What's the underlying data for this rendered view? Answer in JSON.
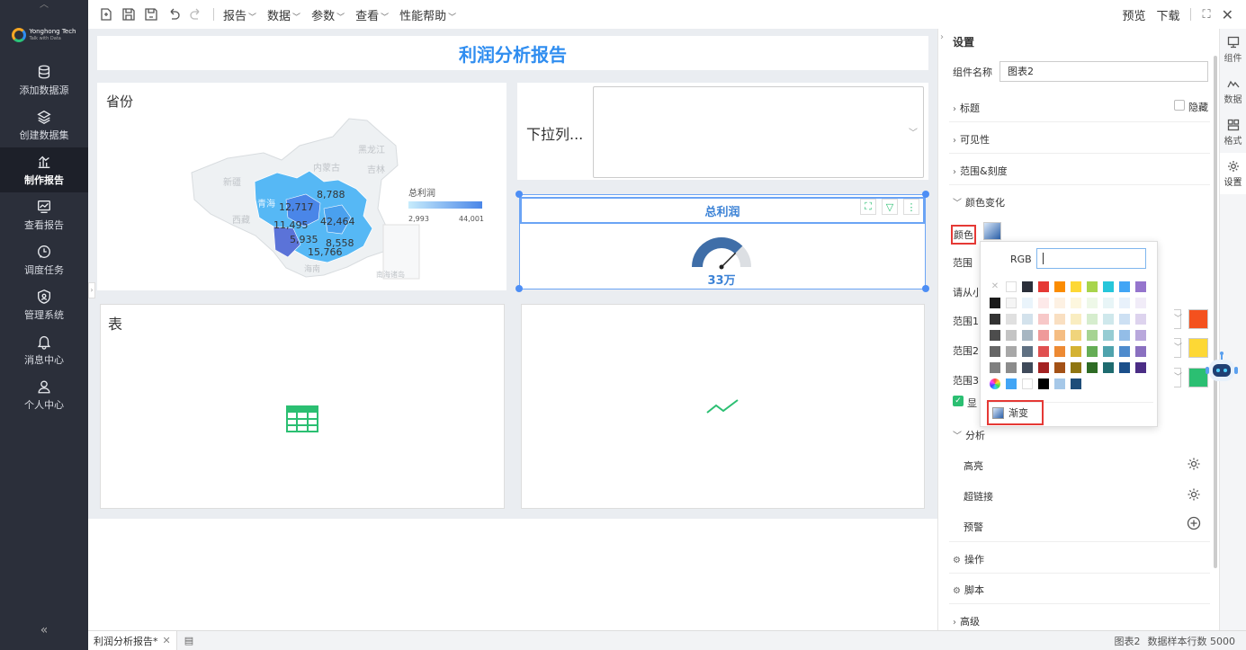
{
  "sidebar": {
    "brand": "Yonghong Tech",
    "brand_sub": "Talk with Data",
    "items": [
      {
        "label": "添加数据源",
        "icon": "database-icon"
      },
      {
        "label": "创建数据集",
        "icon": "layers-icon"
      },
      {
        "label": "制作报告",
        "icon": "chart-report-icon",
        "active": true
      },
      {
        "label": "查看报告",
        "icon": "view-report-icon"
      },
      {
        "label": "调度任务",
        "icon": "clock-icon"
      },
      {
        "label": "管理系统",
        "icon": "shield-icon"
      },
      {
        "label": "消息中心",
        "icon": "bell-icon"
      },
      {
        "label": "个人中心",
        "icon": "user-icon"
      }
    ],
    "collapse": "«"
  },
  "toolbar": {
    "menus": [
      "报告",
      "数据",
      "参数",
      "查看",
      "性能帮助"
    ],
    "preview": "预览",
    "download": "下载"
  },
  "report": {
    "title": "利润分析报告",
    "map": {
      "title": "省份",
      "legend_title": "总利润",
      "legend_min": "2,993",
      "legend_max": "44,001",
      "regions": [
        "黑龙江",
        "吉林",
        "内蒙古",
        "新疆",
        "西藏",
        "青海",
        "海南",
        "南海诸岛"
      ],
      "values": [
        "8,788",
        "12,717",
        "42,464",
        "11,495",
        "5,935",
        "8,558",
        "15,766"
      ]
    },
    "dropdown": {
      "label": "下拉列..."
    },
    "gauge": {
      "title": "总利润",
      "value": "33万",
      "fraction": 0.75
    },
    "table": {
      "title": "表"
    }
  },
  "panel": {
    "title": "设置",
    "name_label": "组件名称",
    "name_value": "图表2",
    "sections": {
      "title": "标题",
      "hide": "隐藏",
      "visibility": "可见性",
      "range_scale": "范围&刻度",
      "color_change": "颜色变化",
      "color": "颜色",
      "range": "范围",
      "hint": "请从小",
      "range1": "范围1",
      "range2": "范围2",
      "range3": "范围3",
      "show": "显",
      "analysis": "分析",
      "highlight": "高亮",
      "hyperlink": "超链接",
      "alert": "预警",
      "operation": "操作",
      "script": "脚本",
      "advanced": "高级"
    },
    "range_colors": [
      "#f4511e",
      "#fdd835",
      "#2bbf72"
    ]
  },
  "tabs": [
    "组件",
    "数据",
    "格式",
    "设置"
  ],
  "popover": {
    "rgb_label": "RGB",
    "gradient_label": "渐变",
    "row0": [
      "none",
      "#ffffff",
      "#2b2f3a",
      "#e53935",
      "#fb8c00",
      "#fdd835",
      "#a8d44b",
      "#26c6da",
      "#42a5f5",
      "#9575cd"
    ],
    "grid_rows": [
      [
        "#1b1b1b",
        "#f5f5f5",
        "#eaf4fb",
        "#fde9e9",
        "#fdf1e3",
        "#fdf7de",
        "#eef8e8",
        "#e8f5f7",
        "#e8f1fb",
        "#f1ecf8"
      ],
      [
        "#333333",
        "#e0e0e0",
        "#d3e2ec",
        "#f7c8c8",
        "#f9dfc1",
        "#f9edc1",
        "#d6edce",
        "#cfe8ec",
        "#cde0f3",
        "#ddd3ee"
      ],
      [
        "#4d4d4d",
        "#c4c4c4",
        "#a7b6c2",
        "#ef9a9a",
        "#f5bd82",
        "#f0d47c",
        "#a6d392",
        "#96ccd3",
        "#93bde7",
        "#b9a8dc"
      ],
      [
        "#666666",
        "#a8a8a8",
        "#5f7082",
        "#e05050",
        "#ed8a33",
        "#d4b232",
        "#65ad55",
        "#4fa3ad",
        "#4e8bcd",
        "#8a70c0"
      ],
      [
        "#808080",
        "#8c8c8c",
        "#3f4a5a",
        "#a32222",
        "#a35116",
        "#8f7612",
        "#2e6b24",
        "#1e6b6f",
        "#1b4f8a",
        "#4b2d85"
      ]
    ],
    "row_last": [
      "rainbow",
      "#42a5f5",
      "#ffffff",
      "#000000",
      "#a6c8e8",
      "#1f4e79"
    ]
  },
  "status": {
    "tab": "利润分析报告*",
    "component": "图表2",
    "rows": "数据样本行数 5000"
  }
}
